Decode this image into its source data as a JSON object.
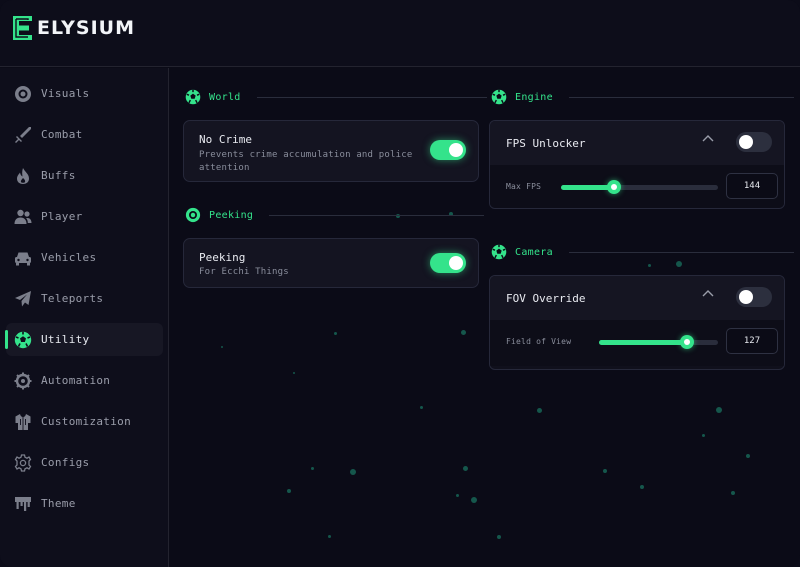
{
  "app": {
    "name": "ELYSIUM",
    "accent": "#34e38b"
  },
  "sidebar": {
    "items": [
      {
        "label": "Visuals",
        "icon": "eye-icon"
      },
      {
        "label": "Combat",
        "icon": "sword-icon"
      },
      {
        "label": "Buffs",
        "icon": "flame-icon"
      },
      {
        "label": "Player",
        "icon": "users-icon"
      },
      {
        "label": "Vehicles",
        "icon": "car-icon"
      },
      {
        "label": "Teleports",
        "icon": "paper-plane-icon"
      },
      {
        "label": "Utility",
        "icon": "soccer-ball-icon",
        "active": true
      },
      {
        "label": "Automation",
        "icon": "gear-cog-icon"
      },
      {
        "label": "Customization",
        "icon": "shirt-icon"
      },
      {
        "label": "Configs",
        "icon": "settings-icon"
      },
      {
        "label": "Theme",
        "icon": "paint-drip-icon"
      }
    ]
  },
  "sections": {
    "world": {
      "title": "World",
      "cards": [
        {
          "title": "No Crime",
          "desc": "Prevents crime accumulation and police attention",
          "enabled": true
        }
      ]
    },
    "peeking": {
      "title": "Peeking",
      "cards": [
        {
          "title": "Peeking",
          "desc": "For Ecchi Things",
          "enabled": true
        }
      ]
    },
    "engine": {
      "title": "Engine",
      "panel": {
        "title": "FPS Unlocker",
        "enabled": false,
        "slider": {
          "label": "Max FPS",
          "value": "144",
          "fraction": 0.34
        }
      }
    },
    "camera": {
      "title": "Camera",
      "panel": {
        "title": "FOV Override",
        "enabled": false,
        "slider": {
          "label": "Field of View",
          "value": "127",
          "fraction": 0.74
        }
      }
    }
  }
}
